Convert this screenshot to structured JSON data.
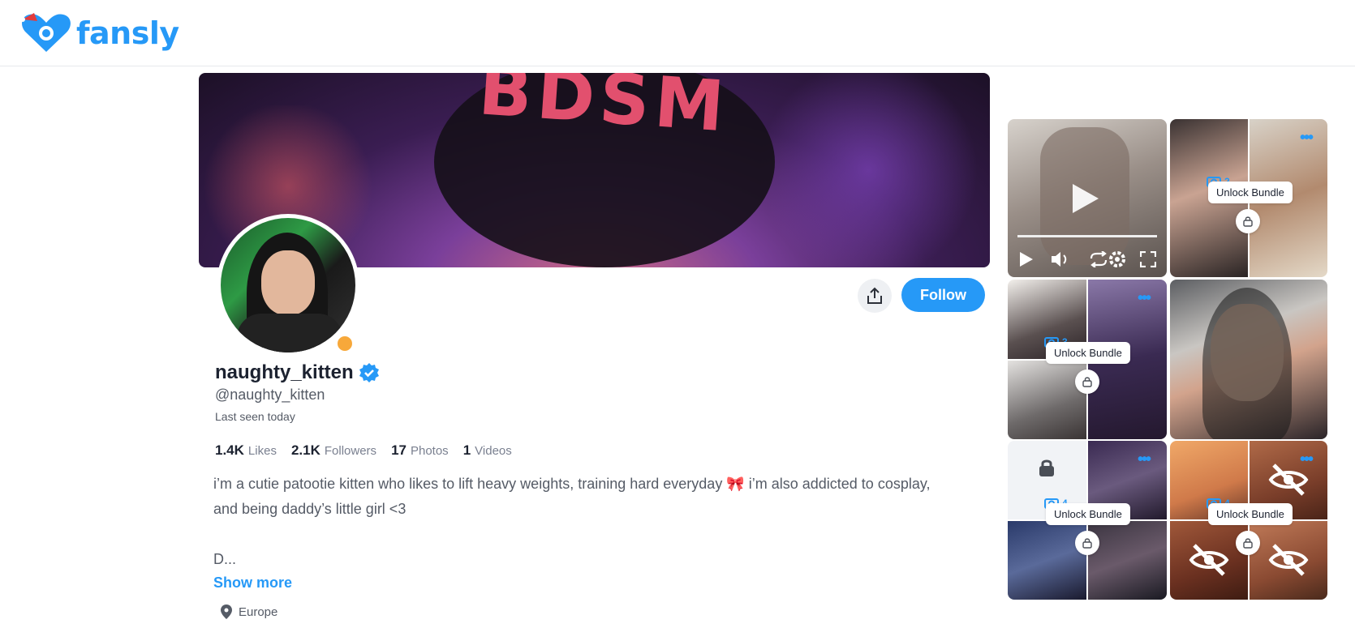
{
  "brand": {
    "name": "fansly",
    "accent": "#2699f7"
  },
  "profile": {
    "display_name": "naughty_kitten",
    "handle": "@naughty_kitten",
    "last_seen": "Last seen today",
    "verified": true,
    "online_status_color": "#f7a83a",
    "banner_text": "BDSM"
  },
  "actions": {
    "follow_label": "Follow",
    "share_icon": "share-icon"
  },
  "stats": [
    {
      "value": "1.4K",
      "label": "Likes"
    },
    {
      "value": "2.1K",
      "label": "Followers"
    },
    {
      "value": "17",
      "label": "Photos"
    },
    {
      "value": "1",
      "label": "Videos"
    }
  ],
  "bio": {
    "line1": "i’m a cutie patootie kitten who likes to lift heavy weights, training hard everyday 🎀  i’m also addicted to cosplay,",
    "line2": "and being daddy’s little girl <3",
    "truncated": "D...",
    "show_more": "Show more"
  },
  "location": "Europe",
  "media": {
    "video_controls": [
      "play-icon",
      "volume-icon",
      "loop-icon",
      "settings-icon",
      "fullscreen-icon"
    ],
    "bundles": [
      {
        "count": "2",
        "label": "Unlock Bundle"
      },
      {
        "count": "3",
        "label": "Unlock Bundle"
      },
      {
        "count": "4",
        "label": "Unlock Bundle"
      },
      {
        "count": "4",
        "label": "Unlock Bundle"
      }
    ]
  }
}
